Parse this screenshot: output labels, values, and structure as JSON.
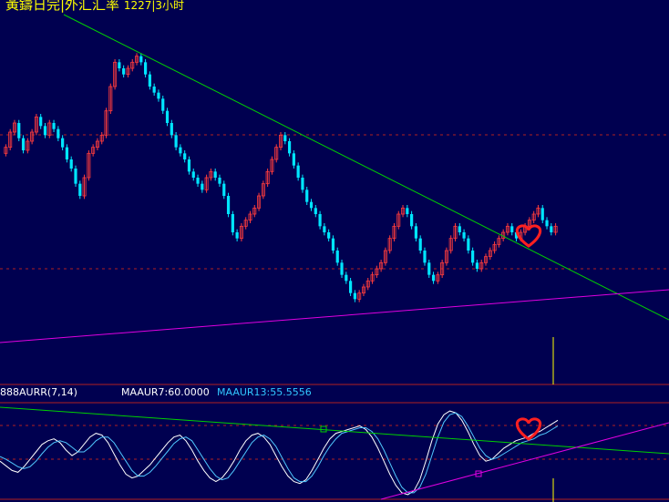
{
  "header": {
    "title": "黃鑄日完|外汇汇率",
    "period": "1227|3小时"
  },
  "indicator": {
    "name": "888AURR(7,14)",
    "ma1_label": "MAAUR7:60.0000",
    "ma2_label": "MAAUR13:55.5556"
  },
  "colors": {
    "background": "#000050",
    "up_candle": "#ff3c3c",
    "down_candle": "#00e6ff",
    "trendline_down": "#00d000",
    "trendline_up": "#e000e0",
    "grid": "#b02020",
    "heart": "#ff2020",
    "marker_line": "#ffff00",
    "line_white": "#ffffff",
    "line_cyan": "#50c8ff"
  },
  "annotations": {
    "price_pane_marker": "heart-icon",
    "indicator_pane_marker": "heart-icon"
  },
  "chart_data": [
    {
      "type": "candlestick",
      "pane": "price",
      "count": 127,
      "open": [
        98,
        100,
        105,
        108,
        103,
        99,
        102,
        105,
        110,
        107,
        104,
        108,
        106,
        103,
        100,
        96,
        93,
        88,
        84,
        90,
        98,
        100,
        102,
        104,
        112,
        120,
        128,
        126,
        124,
        126,
        128,
        130,
        128,
        124,
        120,
        118,
        116,
        112,
        108,
        104,
        100,
        98,
        96,
        92,
        90,
        88,
        86,
        90,
        92,
        90,
        88,
        84,
        78,
        72,
        70,
        74,
        76,
        78,
        80,
        84,
        88,
        92,
        96,
        100,
        104,
        102,
        98,
        94,
        90,
        86,
        82,
        80,
        78,
        74,
        72,
        70,
        66,
        62,
        58,
        56,
        52,
        50,
        52,
        54,
        56,
        58,
        60,
        62,
        66,
        70,
        74,
        78,
        80,
        78,
        74,
        70,
        66,
        62,
        58,
        56,
        58,
        62,
        66,
        70,
        74,
        72,
        70,
        66,
        62,
        60,
        62,
        64,
        66,
        68,
        70,
        72,
        74,
        72,
        70,
        72,
        74,
        76,
        78,
        80,
        76,
        74,
        72
      ],
      "close": [
        100,
        105,
        108,
        103,
        99,
        102,
        105,
        110,
        107,
        104,
        108,
        106,
        103,
        100,
        96,
        93,
        88,
        84,
        90,
        98,
        100,
        102,
        104,
        112,
        120,
        128,
        126,
        124,
        126,
        128,
        130,
        128,
        124,
        120,
        118,
        116,
        112,
        108,
        104,
        100,
        98,
        96,
        92,
        90,
        88,
        86,
        90,
        92,
        90,
        88,
        84,
        78,
        72,
        70,
        74,
        76,
        78,
        80,
        84,
        88,
        92,
        96,
        100,
        104,
        102,
        98,
        94,
        90,
        86,
        82,
        80,
        78,
        74,
        72,
        70,
        66,
        62,
        58,
        56,
        52,
        50,
        52,
        54,
        56,
        58,
        60,
        62,
        66,
        70,
        74,
        78,
        80,
        78,
        74,
        70,
        66,
        62,
        58,
        56,
        58,
        62,
        66,
        70,
        74,
        72,
        70,
        66,
        62,
        60,
        62,
        64,
        66,
        68,
        70,
        72,
        74,
        72,
        70,
        72,
        74,
        76,
        78,
        80,
        76,
        74,
        72,
        74
      ],
      "high": [
        101,
        106,
        109,
        109,
        104,
        103,
        106,
        111,
        111,
        108,
        109,
        109,
        107,
        104,
        101,
        97,
        94,
        89,
        91,
        99,
        101,
        103,
        105,
        113,
        121,
        129,
        129,
        127,
        127,
        129,
        131,
        131,
        129,
        125,
        121,
        119,
        117,
        113,
        109,
        105,
        101,
        99,
        97,
        93,
        91,
        89,
        91,
        93,
        93,
        91,
        89,
        85,
        79,
        73,
        75,
        77,
        79,
        81,
        85,
        89,
        93,
        97,
        101,
        105,
        105,
        103,
        99,
        95,
        91,
        87,
        83,
        81,
        79,
        75,
        73,
        71,
        67,
        63,
        59,
        57,
        53,
        53,
        55,
        57,
        59,
        61,
        63,
        67,
        71,
        75,
        79,
        81,
        81,
        79,
        75,
        71,
        67,
        63,
        59,
        59,
        63,
        67,
        71,
        75,
        75,
        73,
        71,
        67,
        63,
        63,
        65,
        67,
        69,
        71,
        73,
        75,
        75,
        73,
        73,
        75,
        77,
        79,
        81,
        81,
        77,
        75,
        75
      ],
      "low": [
        97,
        99,
        104,
        102,
        98,
        98,
        101,
        104,
        106,
        103,
        103,
        105,
        102,
        99,
        95,
        92,
        87,
        83,
        83,
        89,
        97,
        99,
        101,
        103,
        111,
        119,
        125,
        123,
        123,
        125,
        127,
        127,
        123,
        119,
        117,
        115,
        111,
        107,
        103,
        99,
        97,
        95,
        91,
        89,
        87,
        85,
        85,
        89,
        89,
        87,
        83,
        77,
        71,
        69,
        69,
        73,
        75,
        77,
        79,
        83,
        87,
        91,
        95,
        99,
        101,
        97,
        93,
        89,
        85,
        81,
        79,
        77,
        73,
        71,
        69,
        65,
        61,
        57,
        55,
        51,
        49,
        49,
        51,
        53,
        55,
        57,
        59,
        61,
        65,
        69,
        73,
        77,
        77,
        73,
        69,
        65,
        61,
        57,
        55,
        55,
        57,
        61,
        65,
        69,
        71,
        69,
        65,
        61,
        59,
        59,
        61,
        63,
        65,
        67,
        69,
        71,
        71,
        69,
        69,
        71,
        73,
        75,
        77,
        75,
        73,
        71,
        71
      ]
    },
    {
      "type": "line",
      "pane": "indicator",
      "series": [
        {
          "color": "white",
          "values": [
            40,
            35,
            30,
            28,
            34,
            42,
            50,
            58,
            62,
            64,
            60,
            52,
            46,
            50,
            58,
            66,
            70,
            68,
            60,
            48,
            36,
            26,
            22,
            24,
            30,
            36,
            44,
            52,
            60,
            66,
            68,
            62,
            52,
            40,
            30,
            22,
            18,
            22,
            30,
            40,
            52,
            62,
            68,
            70,
            66,
            58,
            46,
            34,
            24,
            18,
            16,
            20,
            30,
            42,
            54,
            64,
            70,
            72,
            74,
            76,
            78,
            74,
            66,
            54,
            40,
            26,
            14,
            6,
            4,
            8,
            20,
            40,
            62,
            80,
            90,
            94,
            92,
            84,
            72,
            58,
            46,
            40,
            42,
            48,
            54,
            58,
            62,
            64,
            66,
            70,
            72,
            76,
            80,
            84
          ]
        },
        {
          "color": "cyan",
          "values": [
            45,
            42,
            38,
            34,
            32,
            34,
            40,
            48,
            55,
            60,
            62,
            60,
            55,
            50,
            50,
            55,
            62,
            66,
            66,
            60,
            50,
            40,
            30,
            24,
            24,
            28,
            35,
            43,
            51,
            59,
            64,
            66,
            62,
            52,
            42,
            32,
            24,
            20,
            22,
            30,
            40,
            50,
            60,
            66,
            68,
            64,
            56,
            44,
            32,
            22,
            18,
            18,
            24,
            34,
            46,
            56,
            64,
            70,
            72,
            74,
            76,
            76,
            72,
            64,
            52,
            38,
            24,
            12,
            6,
            6,
            12,
            26,
            46,
            66,
            82,
            90,
            92,
            88,
            78,
            66,
            54,
            46,
            42,
            44,
            48,
            52,
            56,
            60,
            62,
            64,
            68,
            70,
            74,
            78
          ]
        }
      ]
    }
  ]
}
